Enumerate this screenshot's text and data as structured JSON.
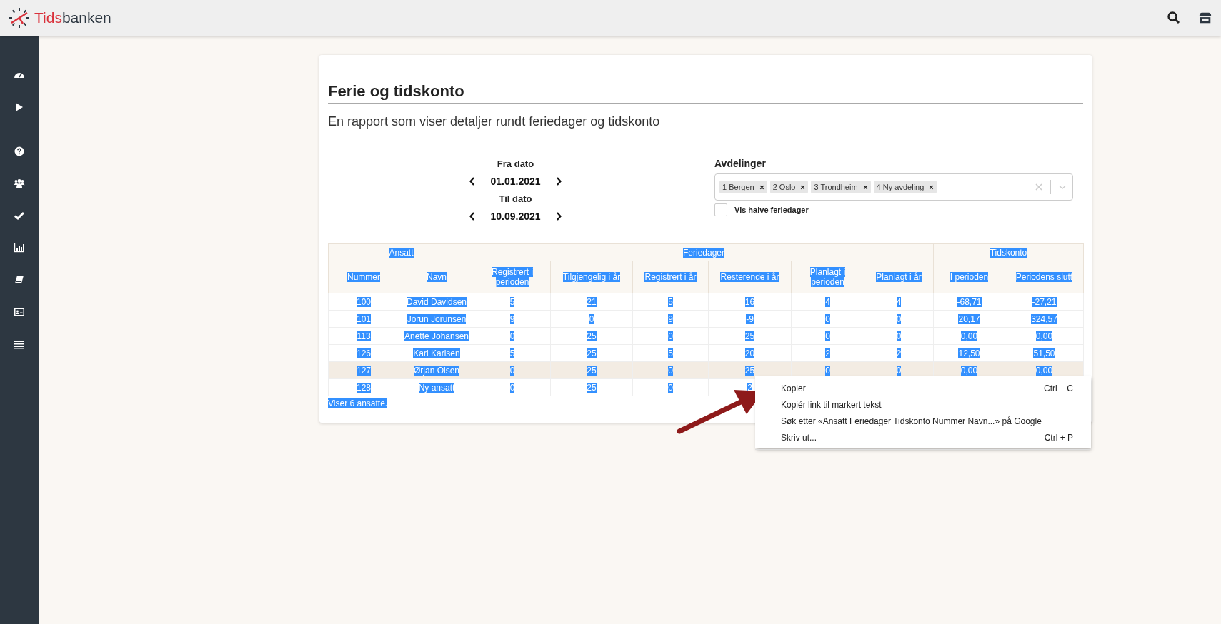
{
  "brand": {
    "first": "Tids",
    "second": "banken"
  },
  "report": {
    "title": "Ferie og tidskonto",
    "subtitle": "En rapport som viser detaljer rundt feriedager og tidskonto"
  },
  "dates": [
    {
      "label": "Fra dato",
      "value": "01.01.2021"
    },
    {
      "label": "Til dato",
      "value": "10.09.2021"
    }
  ],
  "departments": {
    "label": "Avdelinger",
    "tags": [
      "1 Bergen",
      "2 Oslo",
      "3 Trondheim",
      "4 Ny avdeling"
    ]
  },
  "half_days": {
    "label": "Vis halve feriedager",
    "checked": false
  },
  "table": {
    "groups": [
      "Ansatt",
      "Feriedager",
      "Tidskonto"
    ],
    "columns": [
      "Nummer",
      "Navn",
      "Registrert i perioden",
      "Tilgjengelig i år",
      "Registrert i år",
      "Resterende i år",
      "Planlagt i perioden",
      "Planlagt i år",
      "I perioden",
      "Periodens slutt"
    ],
    "rows": [
      {
        "highlighted": false,
        "cells": [
          "100",
          "David Davidsen",
          "5",
          "21",
          "5",
          "16",
          "4",
          "4",
          "-68,71",
          "-27,21"
        ]
      },
      {
        "highlighted": false,
        "cells": [
          "101",
          "Jorun Jorunsen",
          "9",
          "0",
          "9",
          "-9",
          "0",
          "0",
          "20,17",
          "324,57"
        ]
      },
      {
        "highlighted": false,
        "cells": [
          "113",
          "Anette Johansen",
          "0",
          "25",
          "0",
          "25",
          "0",
          "0",
          "0,00",
          "0,00"
        ]
      },
      {
        "highlighted": false,
        "cells": [
          "126",
          "Kari Karisen",
          "5",
          "25",
          "5",
          "20",
          "2",
          "2",
          "12,50",
          "51,50"
        ]
      },
      {
        "highlighted": true,
        "cells": [
          "127",
          "Ørjan Olsen",
          "0",
          "25",
          "0",
          "25",
          "0",
          "0",
          "0,00",
          "0,00"
        ]
      },
      {
        "highlighted": false,
        "cells": [
          "128",
          "Ny ansatt",
          "0",
          "25",
          "0",
          "2"
        ]
      }
    ],
    "footer": "Viser 6 ansatte."
  },
  "context_menu": {
    "items": [
      {
        "label": "Kopier",
        "shortcut": "Ctrl + C"
      },
      {
        "label": "Kopiér link til markert tekst"
      },
      {
        "label": "Søk etter «Ansatt Feriedager Tidskonto Nummer Navn...» på Google"
      },
      {
        "label": "Skriv ut...",
        "shortcut": "Ctrl + P"
      }
    ]
  }
}
